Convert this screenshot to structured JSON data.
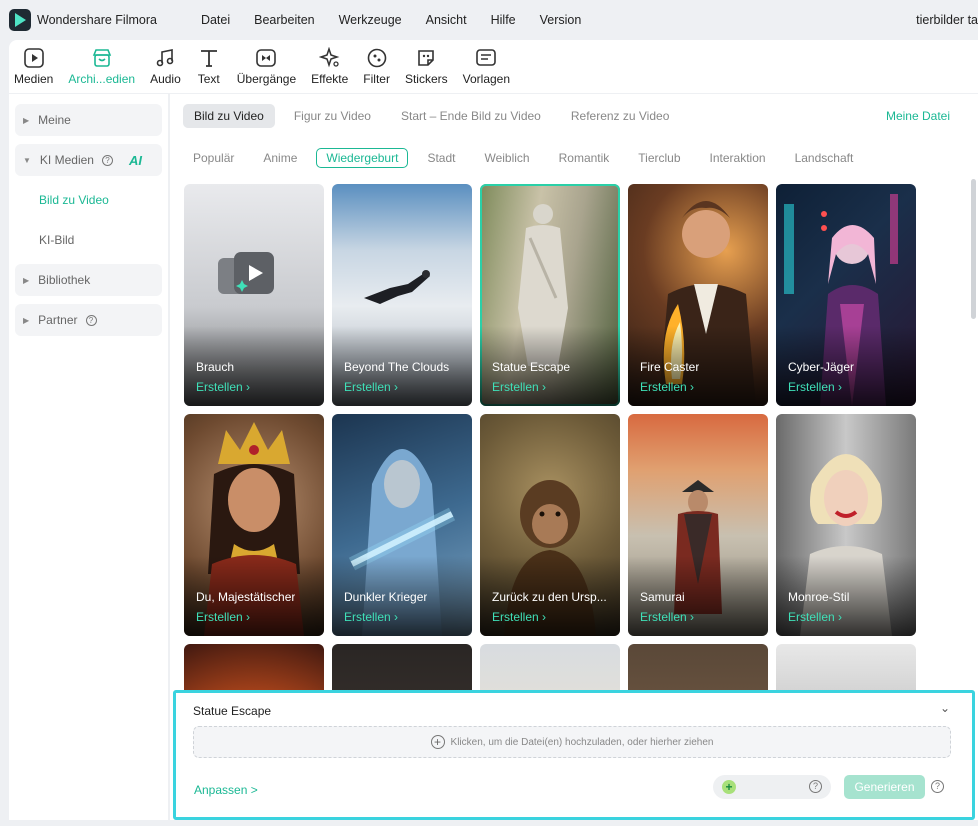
{
  "app": {
    "title": "Wondershare Filmora",
    "user_title": "tierbilder ta"
  },
  "menu": [
    "Datei",
    "Bearbeiten",
    "Werkzeuge",
    "Ansicht",
    "Hilfe",
    "Version"
  ],
  "toolbar": [
    {
      "label": "Medien",
      "icon": "media-icon"
    },
    {
      "label": "Archi...edien",
      "icon": "archive-store-icon",
      "active": true
    },
    {
      "label": "Audio",
      "icon": "music-note-icon"
    },
    {
      "label": "Text",
      "icon": "text-t-icon"
    },
    {
      "label": "Übergänge",
      "icon": "transition-icon"
    },
    {
      "label": "Effekte",
      "icon": "effects-sparkle-icon"
    },
    {
      "label": "Filter",
      "icon": "filter-icon"
    },
    {
      "label": "Stickers",
      "icon": "sticker-icon"
    },
    {
      "label": "Vorlagen",
      "icon": "template-icon"
    }
  ],
  "sidebar": {
    "meine": "Meine",
    "ki_medien": "KI Medien",
    "ai_badge": "AI",
    "bild_zu_video": "Bild zu Video",
    "ki_bild": "KI-Bild",
    "bibliothek": "Bibliothek",
    "partner": "Partner"
  },
  "tabs": [
    "Bild zu Video",
    "Figur zu Video",
    "Start – Ende Bild zu Video",
    "Referenz zu Video"
  ],
  "my_file": "Meine Datei",
  "categories": [
    "Populär",
    "Anime",
    "Wiedergeburt",
    "Stadt",
    "Weiblich",
    "Romantik",
    "Tierclub",
    "Interaktion",
    "Landschaft"
  ],
  "active_category": "Wiedergeburt",
  "create_label": "Erstellen",
  "cards": [
    {
      "name": "Brauch"
    },
    {
      "name": "Beyond The Clouds"
    },
    {
      "name": "Statue Escape",
      "selected": true
    },
    {
      "name": "Fire Caster"
    },
    {
      "name": "Cyber-Jäger"
    },
    {
      "name": "Du, Majestätischer"
    },
    {
      "name": "Dunkler Krieger"
    },
    {
      "name": "Zurück zu den Ursp..."
    },
    {
      "name": "Samurai"
    },
    {
      "name": "Monroe-Stil"
    }
  ],
  "panel": {
    "title": "Statue Escape",
    "upload_text": "Klicken, um die Datei(en) hochzuladen, oder hierher ziehen",
    "customize": "Anpassen >",
    "generate": "Generieren"
  },
  "colors": {
    "accent": "#1bb894",
    "highlight_border": "#3ad3df"
  }
}
